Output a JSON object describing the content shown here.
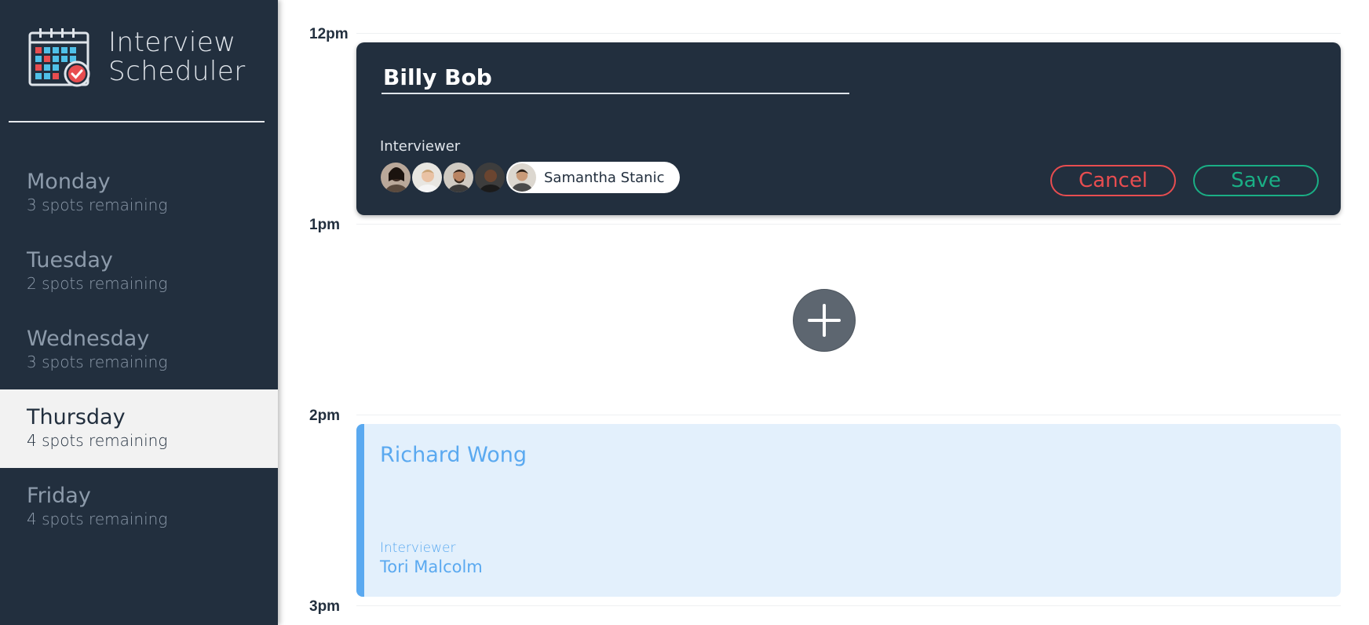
{
  "app": {
    "title": "Interview\nScheduler"
  },
  "days": [
    {
      "name": "Monday",
      "spots": "3 spots remaining",
      "selected": false
    },
    {
      "name": "Tuesday",
      "spots": "2 spots remaining",
      "selected": false
    },
    {
      "name": "Wednesday",
      "spots": "3 spots remaining",
      "selected": false
    },
    {
      "name": "Thursday",
      "spots": "4 spots remaining",
      "selected": true
    },
    {
      "name": "Friday",
      "spots": "4 spots remaining",
      "selected": false
    }
  ],
  "schedule": {
    "times": [
      "12pm",
      "1pm",
      "2pm",
      "3pm"
    ],
    "edit_form": {
      "student_value": "Billy Bob",
      "interviewer_label": "Interviewer",
      "selected_interviewer": "Samantha Stanic",
      "cancel_label": "Cancel",
      "save_label": "Save"
    },
    "add_icon": "plus-icon",
    "appointment": {
      "student": "Richard Wong",
      "interviewer_label": "Interviewer",
      "interviewer_name": "Tori Malcolm"
    }
  },
  "colors": {
    "sidebar_bg": "#222f3e",
    "cancel": "#e84d50",
    "save": "#1aaf85",
    "appointment_accent": "#5aa9f0",
    "appointment_bg": "#e3f0fc"
  }
}
